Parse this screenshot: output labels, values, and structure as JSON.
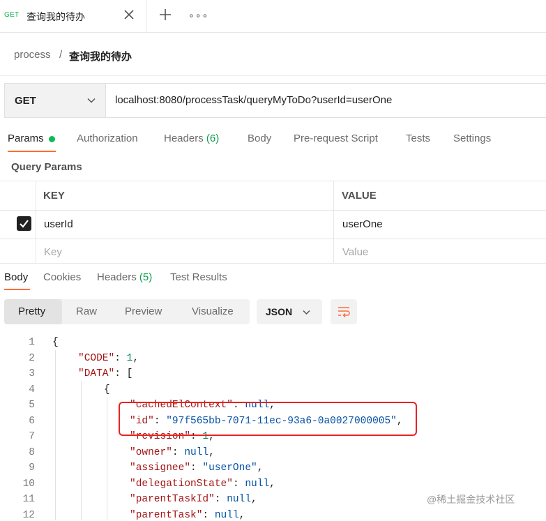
{
  "tab": {
    "method": "GET",
    "title": "查询我的待办",
    "more": "∘∘∘"
  },
  "breadcrumb": {
    "parent": "process",
    "separator": "/",
    "current": "查询我的待办"
  },
  "request": {
    "method": "GET",
    "url": "localhost:8080/processTask/queryMyToDo?userId=userOne"
  },
  "request_tabs": {
    "params": "Params",
    "authorization": "Authorization",
    "headers": "Headers",
    "headers_count": "(6)",
    "body": "Body",
    "prerequest": "Pre-request Script",
    "tests": "Tests",
    "settings": "Settings"
  },
  "query_params": {
    "title": "Query Params",
    "key_header": "KEY",
    "value_header": "VALUE",
    "rows": [
      {
        "checked": true,
        "key": "userId",
        "value": "userOne"
      }
    ],
    "key_placeholder": "Key",
    "value_placeholder": "Value"
  },
  "response_tabs": {
    "body": "Body",
    "cookies": "Cookies",
    "headers": "Headers",
    "headers_count": "(5)",
    "test_results": "Test Results"
  },
  "format": {
    "pretty": "Pretty",
    "raw": "Raw",
    "preview": "Preview",
    "visualize": "Visualize",
    "language": "JSON"
  },
  "code": {
    "line_numbers": [
      "1",
      "2",
      "3",
      "4",
      "5",
      "6",
      "7",
      "8",
      "9",
      "10",
      "11",
      "12"
    ],
    "lines": [
      {
        "indent": 0,
        "tokens": [
          {
            "t": "{",
            "c": "p"
          }
        ]
      },
      {
        "indent": 1,
        "tokens": [
          {
            "t": "\"CODE\"",
            "c": "k"
          },
          {
            "t": ": ",
            "c": "p"
          },
          {
            "t": "1",
            "c": "n"
          },
          {
            "t": ",",
            "c": "p"
          }
        ]
      },
      {
        "indent": 1,
        "tokens": [
          {
            "t": "\"DATA\"",
            "c": "k"
          },
          {
            "t": ": [",
            "c": "p"
          }
        ]
      },
      {
        "indent": 2,
        "tokens": [
          {
            "t": "{",
            "c": "p"
          }
        ]
      },
      {
        "indent": 3,
        "tokens": [
          {
            "t": "\"cachedElContext\"",
            "c": "k"
          },
          {
            "t": ": ",
            "c": "p"
          },
          {
            "t": "null",
            "c": "nl"
          },
          {
            "t": ",",
            "c": "p"
          }
        ]
      },
      {
        "indent": 3,
        "tokens": [
          {
            "t": "\"id\"",
            "c": "k"
          },
          {
            "t": ": ",
            "c": "p"
          },
          {
            "t": "\"97f565bb-7071-11ec-93a6-0a0027000005\"",
            "c": "s"
          },
          {
            "t": ",",
            "c": "p"
          }
        ]
      },
      {
        "indent": 3,
        "tokens": [
          {
            "t": "\"revision\"",
            "c": "k"
          },
          {
            "t": ": ",
            "c": "p"
          },
          {
            "t": "1",
            "c": "n"
          },
          {
            "t": ",",
            "c": "p"
          }
        ]
      },
      {
        "indent": 3,
        "tokens": [
          {
            "t": "\"owner\"",
            "c": "k"
          },
          {
            "t": ": ",
            "c": "p"
          },
          {
            "t": "null",
            "c": "nl"
          },
          {
            "t": ",",
            "c": "p"
          }
        ]
      },
      {
        "indent": 3,
        "tokens": [
          {
            "t": "\"assignee\"",
            "c": "k"
          },
          {
            "t": ": ",
            "c": "p"
          },
          {
            "t": "\"userOne\"",
            "c": "s"
          },
          {
            "t": ",",
            "c": "p"
          }
        ]
      },
      {
        "indent": 3,
        "tokens": [
          {
            "t": "\"delegationState\"",
            "c": "k"
          },
          {
            "t": ": ",
            "c": "p"
          },
          {
            "t": "null",
            "c": "nl"
          },
          {
            "t": ",",
            "c": "p"
          }
        ]
      },
      {
        "indent": 3,
        "tokens": [
          {
            "t": "\"parentTaskId\"",
            "c": "k"
          },
          {
            "t": ": ",
            "c": "p"
          },
          {
            "t": "null",
            "c": "nl"
          },
          {
            "t": ",",
            "c": "p"
          }
        ]
      },
      {
        "indent": 3,
        "tokens": [
          {
            "t": "\"parentTask\"",
            "c": "k"
          },
          {
            "t": ": ",
            "c": "p"
          },
          {
            "t": "null",
            "c": "nl"
          },
          {
            "t": ",",
            "c": "p"
          }
        ]
      }
    ]
  },
  "watermark": "@稀土掘金技术社区",
  "colors": {
    "accent": "#ff6c37",
    "success": "#0cbb52",
    "highlight_box": "#e8221f"
  }
}
